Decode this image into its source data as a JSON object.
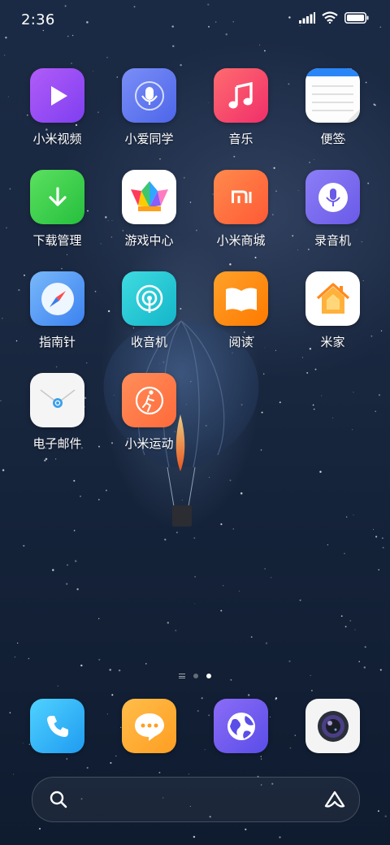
{
  "status_bar": {
    "time": "2:36"
  },
  "apps": [
    {
      "label": "小米视频",
      "icon": "play-icon"
    },
    {
      "label": "小爱同学",
      "icon": "assistant-icon"
    },
    {
      "label": "音乐",
      "icon": "music-icon"
    },
    {
      "label": "便签",
      "icon": "notes-icon"
    },
    {
      "label": "下载管理",
      "icon": "download-icon"
    },
    {
      "label": "游戏中心",
      "icon": "crown-icon"
    },
    {
      "label": "小米商城",
      "icon": "mi-store-icon"
    },
    {
      "label": "录音机",
      "icon": "microphone-icon"
    },
    {
      "label": "指南针",
      "icon": "compass-icon"
    },
    {
      "label": "收音机",
      "icon": "radio-icon"
    },
    {
      "label": "阅读",
      "icon": "book-icon"
    },
    {
      "label": "米家",
      "icon": "home-icon"
    },
    {
      "label": "电子邮件",
      "icon": "email-icon"
    },
    {
      "label": "小米运动",
      "icon": "fitness-icon"
    }
  ],
  "dock": [
    {
      "icon": "phone-icon"
    },
    {
      "icon": "messages-icon"
    },
    {
      "icon": "browser-icon"
    },
    {
      "icon": "camera-icon"
    }
  ],
  "page_indicator": {
    "pages": 2,
    "current": 2
  },
  "search_bar": {
    "left_icon": "search-icon",
    "right_icon": "assistant-logo-icon"
  },
  "colors": {
    "video": "#a64bf0",
    "assistant": "#5b78f0",
    "music": "#f84068",
    "download": "#3bd04a",
    "store": "#ff6a40",
    "recorder": "#7a6cf0",
    "compass": "#5fa3f5",
    "radio": "#20c7cf",
    "reading": "#ff8a00",
    "mijia": "#ff9a2c",
    "fitness": "#ff7a45",
    "phone": "#2ab0f5",
    "messages": "#ffab3a",
    "browser": "#6a5cf5"
  }
}
